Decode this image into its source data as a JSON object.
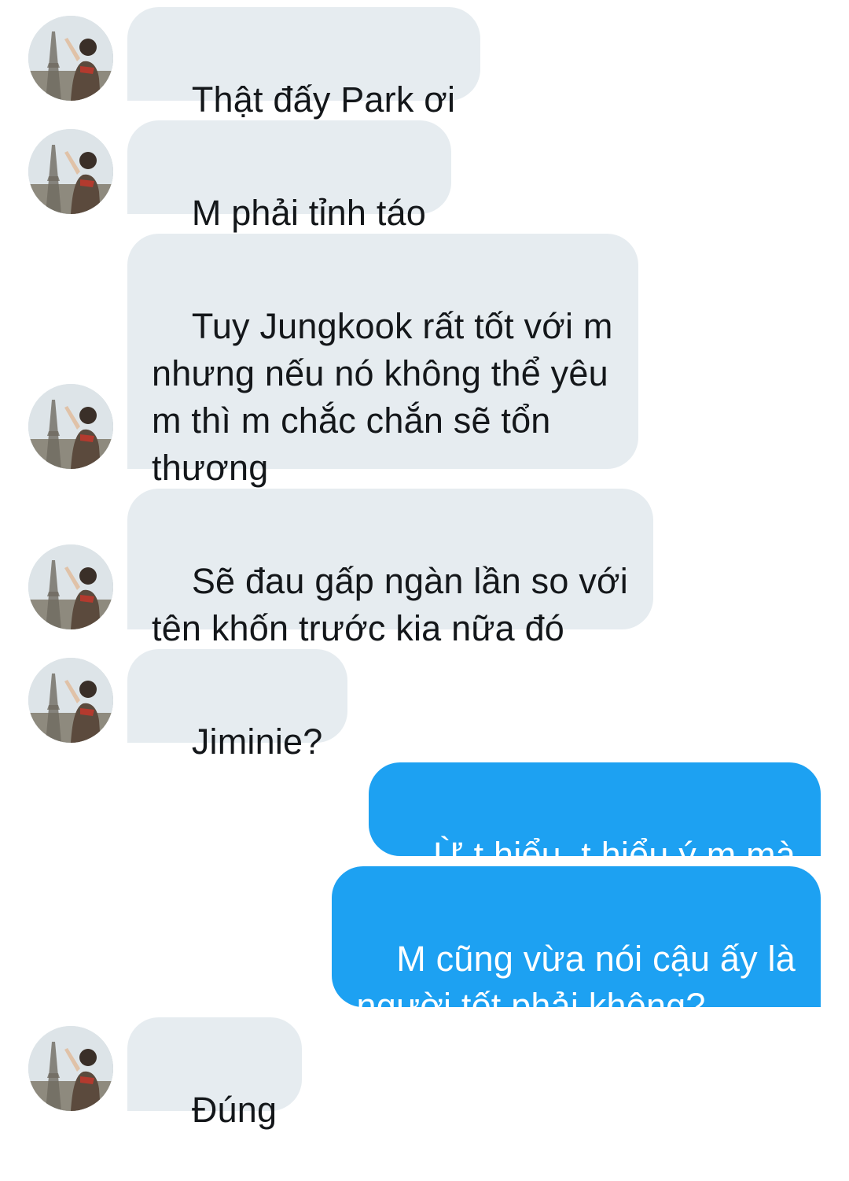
{
  "conversation": {
    "colors": {
      "received_bubble": "#e6ecf0",
      "received_text": "#14171a",
      "sent_bubble": "#1da1f2",
      "sent_text": "#ffffff"
    },
    "avatar_icon": "user-avatar-photo",
    "messages": [
      {
        "direction": "received",
        "text": "Thật đấy Park ơi"
      },
      {
        "direction": "received",
        "text": "M phải tỉnh táo"
      },
      {
        "direction": "received",
        "text": "Tuy Jungkook rất tốt với m\nnhưng nếu nó không thể yêu\nm thì m chắc chắn sẽ tổn\nthương"
      },
      {
        "direction": "received",
        "text": "Sẽ đau gấp ngàn lần so với\ntên khốn trước kia nữa đó"
      },
      {
        "direction": "received",
        "text": "Jiminie?"
      },
      {
        "direction": "sent",
        "text": "Ừ t hiểu, t hiểu ý m mà"
      },
      {
        "direction": "sent",
        "text": "M cũng vừa nói cậu ấy là\nngười tốt phải không?"
      },
      {
        "direction": "received",
        "text": "Đúng"
      }
    ]
  }
}
